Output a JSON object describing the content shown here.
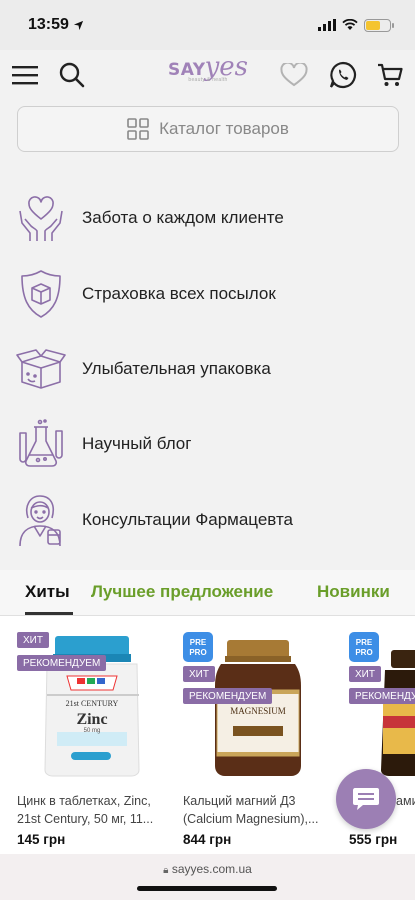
{
  "status": {
    "time": "13:59"
  },
  "header": {
    "logo_main": "SAY",
    "logo_accent": "yes",
    "logo_tagline": "beauty & health"
  },
  "catalog": {
    "label": "Каталог товаров"
  },
  "features": [
    {
      "label": "Забота о каждом клиенте",
      "icon": "hands-heart-icon"
    },
    {
      "label": "Страховка всех посылок",
      "icon": "shield-box-icon"
    },
    {
      "label": "Улыбательная упаковка",
      "icon": "smiling-box-icon"
    },
    {
      "label": "Научный блог",
      "icon": "lab-flask-icon"
    },
    {
      "label": "Консультации Фармацевта",
      "icon": "pharmacist-icon"
    }
  ],
  "tabs": [
    {
      "label": "Хиты",
      "active": true
    },
    {
      "label": "Лучшее предложение",
      "active": false
    },
    {
      "label": "Новинки",
      "active": false
    }
  ],
  "products": [
    {
      "badges": [
        "ХИТ",
        "РЕКОМЕНДУЕМ"
      ],
      "pro": false,
      "name": "Цинк в таблетках, Zinc, 21st Century, 50 мг, 11...",
      "price": "145 грн"
    },
    {
      "badges": [
        "ХИТ",
        "РЕКОМЕНДУЕМ"
      ],
      "pro": true,
      "pro_label": "PRE PRO",
      "name": "Кальций магний Д3 (Calcium Magnesium),...",
      "price": "844 грн"
    },
    {
      "badges": [
        "ХИТ",
        "РЕКОМЕНДУЕМ"
      ],
      "pro": true,
      "pro_label": "PRE PRO",
      "name": "...ой витамин ...",
      "price": "555 грн"
    }
  ],
  "browser": {
    "url": "sayyes.com.ua"
  },
  "colors": {
    "accent": "#9c7fb4",
    "green": "#6a9e2a",
    "pro_blue": "#3d8ee6"
  }
}
